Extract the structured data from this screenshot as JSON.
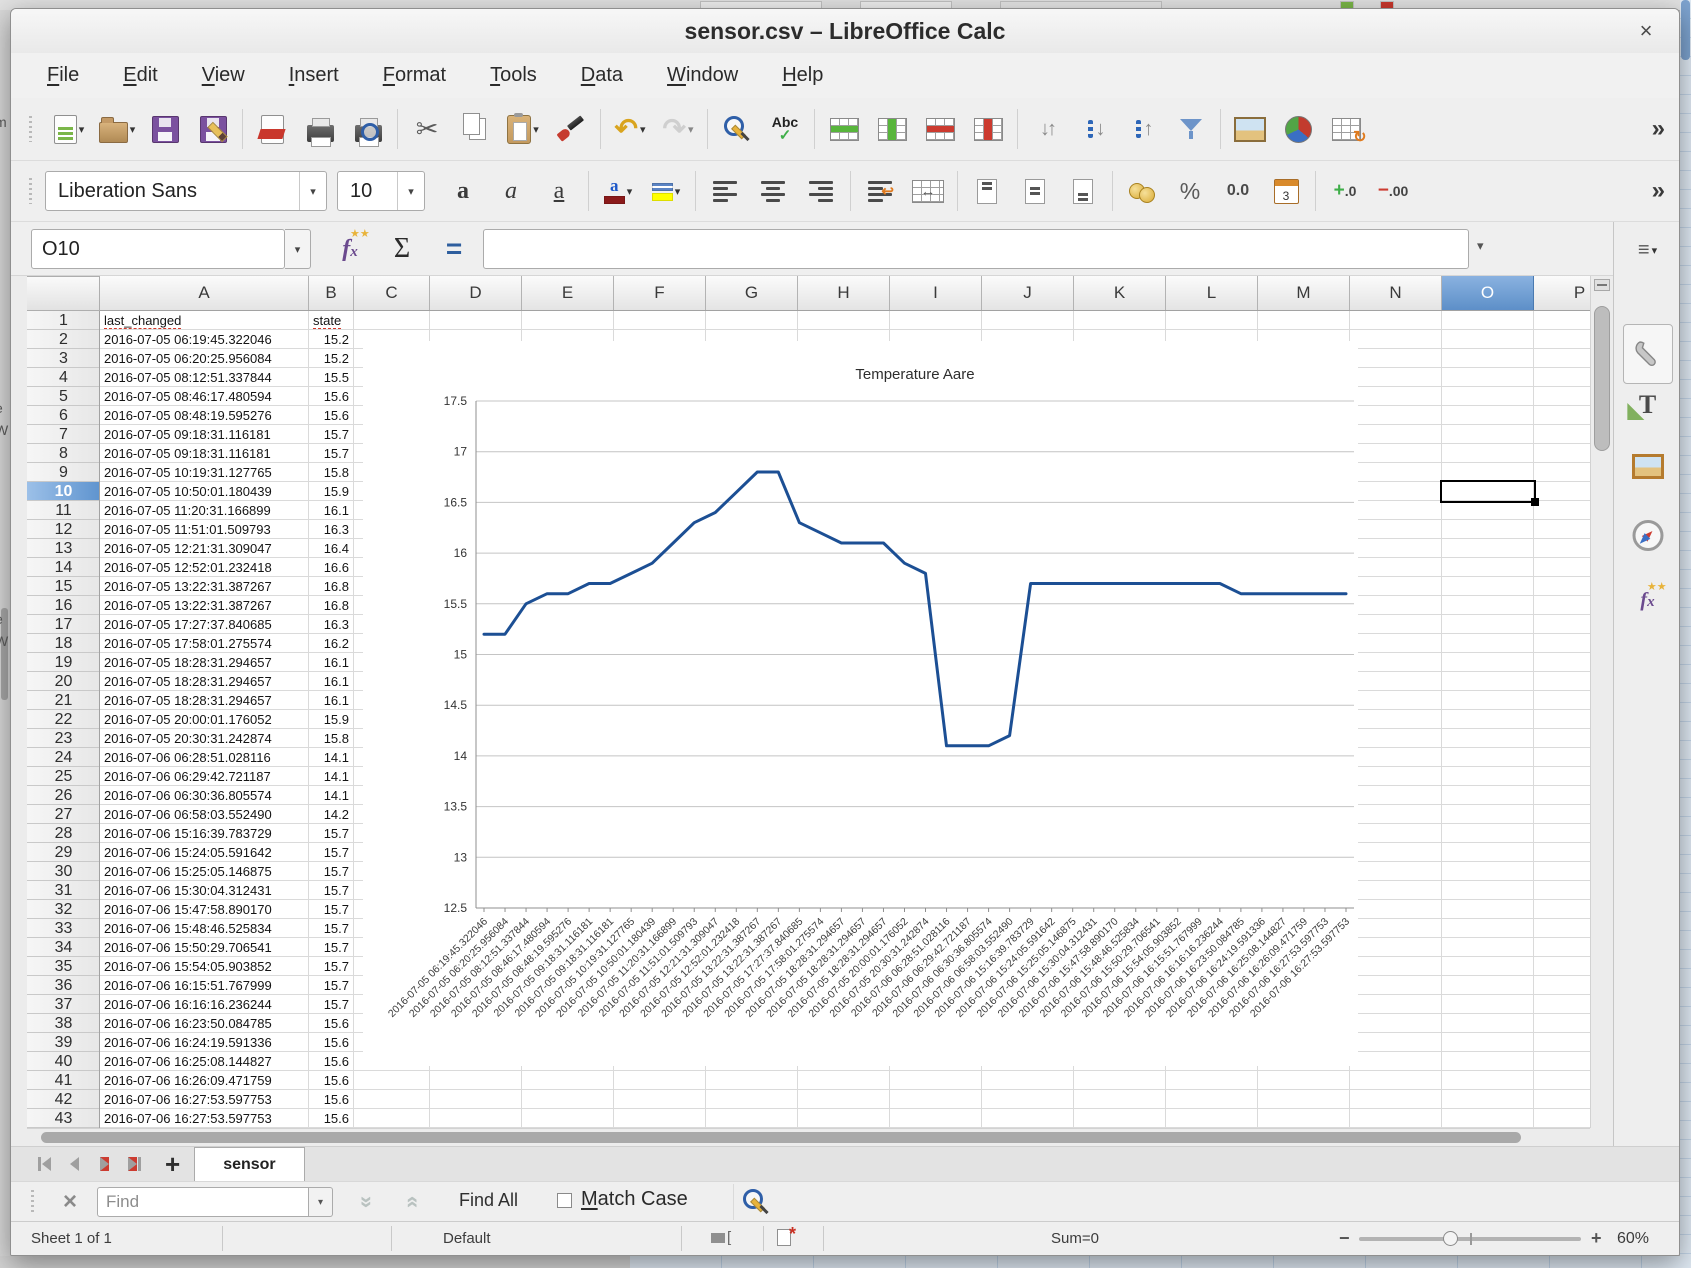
{
  "window": {
    "title": "sensor.csv – LibreOffice Calc",
    "close_label": "×"
  },
  "menu": {
    "items": [
      "File",
      "Edit",
      "View",
      "Insert",
      "Format",
      "Tools",
      "Data",
      "Window",
      "Help"
    ]
  },
  "standard_toolbar": {
    "overflow_label": "»",
    "items": [
      {
        "icon": "new-document",
        "dropdown": true
      },
      {
        "icon": "open",
        "dropdown": true
      },
      {
        "icon": "save"
      },
      {
        "icon": "save-as"
      },
      {
        "sep": true
      },
      {
        "icon": "export-pdf"
      },
      {
        "icon": "print"
      },
      {
        "icon": "print-preview"
      },
      {
        "sep": true
      },
      {
        "icon": "cut"
      },
      {
        "icon": "copy"
      },
      {
        "icon": "paste",
        "dropdown": true
      },
      {
        "icon": "clone-formatting"
      },
      {
        "sep": true
      },
      {
        "icon": "undo",
        "dropdown": true
      },
      {
        "icon": "redo",
        "dropdown": true,
        "disabled": true
      },
      {
        "sep": true
      },
      {
        "icon": "find-and-replace"
      },
      {
        "icon": "spelling"
      },
      {
        "sep": true
      },
      {
        "icon": "insert-rows-above"
      },
      {
        "icon": "insert-columns-before"
      },
      {
        "icon": "delete-rows"
      },
      {
        "icon": "delete-columns"
      },
      {
        "sep": true
      },
      {
        "icon": "sort"
      },
      {
        "icon": "sort-ascending"
      },
      {
        "icon": "sort-descending"
      },
      {
        "icon": "autofilter"
      },
      {
        "sep": true
      },
      {
        "icon": "insert-image"
      },
      {
        "icon": "insert-chart"
      },
      {
        "icon": "pivot-table"
      }
    ]
  },
  "formatting_toolbar": {
    "font_name": "Liberation Sans",
    "font_size": "10",
    "overflow_label": "»",
    "items": [
      {
        "icon": "bold"
      },
      {
        "icon": "italic"
      },
      {
        "icon": "underline"
      },
      {
        "sep": true
      },
      {
        "icon": "font-color",
        "dropdown": true
      },
      {
        "icon": "highlighting-color",
        "dropdown": true
      },
      {
        "sep": true
      },
      {
        "icon": "align-left"
      },
      {
        "icon": "align-center"
      },
      {
        "icon": "align-right"
      },
      {
        "sep": true
      },
      {
        "icon": "wrap-text"
      },
      {
        "icon": "merge-cells"
      },
      {
        "sep": true
      },
      {
        "icon": "align-top"
      },
      {
        "icon": "center-vertically"
      },
      {
        "icon": "align-bottom"
      },
      {
        "sep": true
      },
      {
        "icon": "currency"
      },
      {
        "icon": "percent"
      },
      {
        "icon": "number"
      },
      {
        "icon": "date"
      },
      {
        "sep": true
      },
      {
        "icon": "add-decimal"
      },
      {
        "icon": "delete-decimal"
      }
    ]
  },
  "formula_bar": {
    "name_box": "O10",
    "formula_value": "",
    "icons": [
      "function-wizard",
      "sum",
      "equals"
    ]
  },
  "grid": {
    "columns": [
      "A",
      "B",
      "C",
      "D",
      "E",
      "F",
      "G",
      "H",
      "I",
      "J",
      "K",
      "L",
      "M",
      "N",
      "O",
      "P"
    ],
    "selected_column": "O",
    "selected_row": 10,
    "selected_cell": "O10",
    "rows": [
      [
        "last_changed",
        "state"
      ],
      [
        "2016-07-05 06:19:45.322046",
        "15.2"
      ],
      [
        "2016-07-05 06:20:25.956084",
        "15.2"
      ],
      [
        "2016-07-05 08:12:51.337844",
        "15.5"
      ],
      [
        "2016-07-05 08:46:17.480594",
        "15.6"
      ],
      [
        "2016-07-05 08:48:19.595276",
        "15.6"
      ],
      [
        "2016-07-05 09:18:31.116181",
        "15.7"
      ],
      [
        "2016-07-05 09:18:31.116181",
        "15.7"
      ],
      [
        "2016-07-05 10:19:31.127765",
        "15.8"
      ],
      [
        "2016-07-05 10:50:01.180439",
        "15.9"
      ],
      [
        "2016-07-05 11:20:31.166899",
        "16.1"
      ],
      [
        "2016-07-05 11:51:01.509793",
        "16.3"
      ],
      [
        "2016-07-05 12:21:31.309047",
        "16.4"
      ],
      [
        "2016-07-05 12:52:01.232418",
        "16.6"
      ],
      [
        "2016-07-05 13:22:31.387267",
        "16.8"
      ],
      [
        "2016-07-05 13:22:31.387267",
        "16.8"
      ],
      [
        "2016-07-05 17:27:37.840685",
        "16.3"
      ],
      [
        "2016-07-05 17:58:01.275574",
        "16.2"
      ],
      [
        "2016-07-05 18:28:31.294657",
        "16.1"
      ],
      [
        "2016-07-05 18:28:31.294657",
        "16.1"
      ],
      [
        "2016-07-05 18:28:31.294657",
        "16.1"
      ],
      [
        "2016-07-05 20:00:01.176052",
        "15.9"
      ],
      [
        "2016-07-05 20:30:31.242874",
        "15.8"
      ],
      [
        "2016-07-06 06:28:51.028116",
        "14.1"
      ],
      [
        "2016-07-06 06:29:42.721187",
        "14.1"
      ],
      [
        "2016-07-06 06:30:36.805574",
        "14.1"
      ],
      [
        "2016-07-06 06:58:03.552490",
        "14.2"
      ],
      [
        "2016-07-06 15:16:39.783729",
        "15.7"
      ],
      [
        "2016-07-06 15:24:05.591642",
        "15.7"
      ],
      [
        "2016-07-06 15:25:05.146875",
        "15.7"
      ],
      [
        "2016-07-06 15:30:04.312431",
        "15.7"
      ],
      [
        "2016-07-06 15:47:58.890170",
        "15.7"
      ],
      [
        "2016-07-06 15:48:46.525834",
        "15.7"
      ],
      [
        "2016-07-06 15:50:29.706541",
        "15.7"
      ],
      [
        "2016-07-06 15:54:05.903852",
        "15.7"
      ],
      [
        "2016-07-06 16:15:51.767999",
        "15.7"
      ],
      [
        "2016-07-06 16:16:16.236244",
        "15.7"
      ],
      [
        "2016-07-06 16:23:50.084785",
        "15.6"
      ],
      [
        "2016-07-06 16:24:19.591336",
        "15.6"
      ],
      [
        "2016-07-06 16:25:08.144827",
        "15.6"
      ],
      [
        "2016-07-06 16:26:09.471759",
        "15.6"
      ],
      [
        "2016-07-06 16:27:53.597753",
        "15.6"
      ],
      [
        "2016-07-06 16:27:53.597753",
        "15.6"
      ]
    ]
  },
  "chart_data": {
    "type": "line",
    "title": "Temperature Aare",
    "xlabel": "",
    "ylabel": "",
    "ylim": [
      12.5,
      17.5
    ],
    "ytick_step": 0.5,
    "grid": true,
    "legend": "none",
    "line_color": "#1c4f94",
    "x_labels": [
      "2016-07-05 06:19:45.322046",
      "2016-07-05 06:20:25.956084",
      "2016-07-05 08:12:51.337844",
      "2016-07-05 08:46:17.480594",
      "2016-07-05 08:48:19.595276",
      "2016-07-05 09:18:31.116181",
      "2016-07-05 09:18:31.116181",
      "2016-07-05 10:19:31.127765",
      "2016-07-05 10:50:01.180439",
      "2016-07-05 11:20:31.166899",
      "2016-07-05 11:51:01.509793",
      "2016-07-05 12:21:31.309047",
      "2016-07-05 12:52:01.232418",
      "2016-07-05 13:22:31.387267",
      "2016-07-05 13:22:31.387267",
      "2016-07-05 17:27:37.840685",
      "2016-07-05 17:58:01.275574",
      "2016-07-05 18:28:31.294657",
      "2016-07-05 18:28:31.294657",
      "2016-07-05 18:28:31.294657",
      "2016-07-05 20:00:01.176052",
      "2016-07-05 20:30:31.242874",
      "2016-07-06 06:28:51.028116",
      "2016-07-06 06:29:42.721187",
      "2016-07-06 06:30:36.805574",
      "2016-07-06 06:58:03.552490",
      "2016-07-06 15:16:39.783729",
      "2016-07-06 15:24:05.591642",
      "2016-07-06 15:25:05.146875",
      "2016-07-06 15:30:04.312431",
      "2016-07-06 15:47:58.890170",
      "2016-07-06 15:48:46.525834",
      "2016-07-06 15:50:29.706541",
      "2016-07-06 15:54:05.903852",
      "2016-07-06 16:15:51.767999",
      "2016-07-06 16:16:16.236244",
      "2016-07-06 16:23:50.084785",
      "2016-07-06 16:24:19.591336",
      "2016-07-06 16:25:08.144827",
      "2016-07-06 16:26:09.471759",
      "2016-07-06 16:27:53.597753",
      "2016-07-06 16:27:53.597753"
    ],
    "series": [
      {
        "name": "state",
        "values": [
          15.2,
          15.2,
          15.5,
          15.6,
          15.6,
          15.7,
          15.7,
          15.8,
          15.9,
          16.1,
          16.3,
          16.4,
          16.6,
          16.8,
          16.8,
          16.3,
          16.2,
          16.1,
          16.1,
          16.1,
          15.9,
          15.8,
          14.1,
          14.1,
          14.1,
          14.2,
          15.7,
          15.7,
          15.7,
          15.7,
          15.7,
          15.7,
          15.7,
          15.7,
          15.7,
          15.7,
          15.6,
          15.6,
          15.6,
          15.6,
          15.6,
          15.6
        ]
      }
    ]
  },
  "sheet_tab_bar": {
    "nav_icons": [
      "first-sheet",
      "previous-sheet",
      "next-sheet",
      "last-sheet"
    ],
    "add_label": "+",
    "tabs": [
      "sensor"
    ],
    "active_tab": "sensor"
  },
  "find_toolbar": {
    "placeholder": "Find",
    "find_all_label": "Find All",
    "match_case_label": "Match Case",
    "match_case_checked": false
  },
  "status_bar": {
    "sheet_label": "Sheet 1 of 1",
    "page_style": "Default",
    "sum_label": "Sum=0",
    "zoom_minus": "−",
    "zoom_plus": "+",
    "zoom_level": "60%"
  },
  "sidebar": {
    "icons": [
      "sidebar-settings",
      "properties",
      "styles",
      "gallery",
      "navigator",
      "functions"
    ]
  },
  "background": {
    "edge_text_fragments": [
      "m",
      "e",
      "W",
      "e",
      "W"
    ]
  },
  "colors": {
    "selection_blue": "#5d8fc8",
    "chart_line": "#1c4f94",
    "font_color_swatch": "#8b1a1a",
    "highlight_swatch": "#ffff00"
  }
}
